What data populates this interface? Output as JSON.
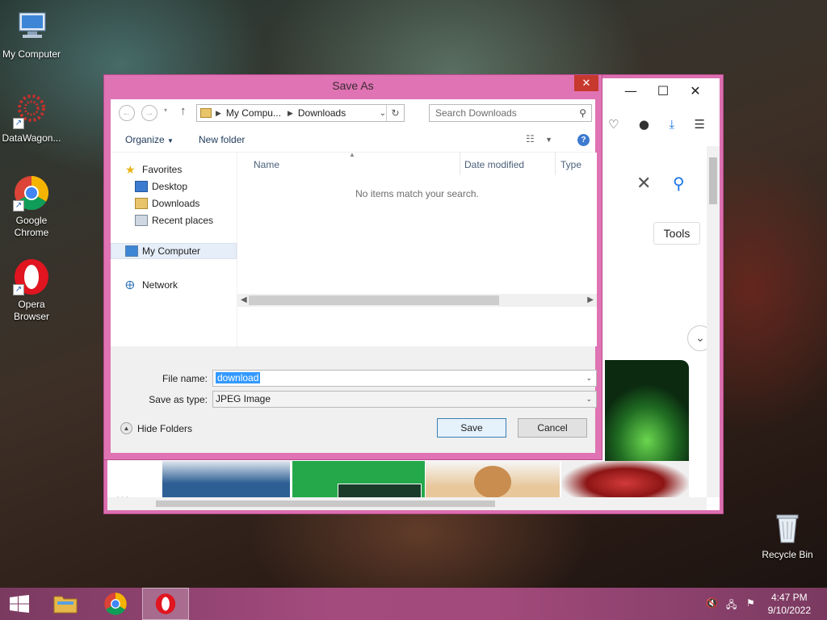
{
  "desktop": {
    "icons": [
      {
        "label": "My Computer",
        "icon": "computer-icon"
      },
      {
        "label": "DataWagon...",
        "icon": "datawagon-icon"
      },
      {
        "label": "Google Chrome",
        "icon": "chrome-icon"
      },
      {
        "label": "Opera Browser",
        "icon": "opera-icon"
      },
      {
        "label": "Recycle Bin",
        "icon": "recycle-bin-icon"
      }
    ]
  },
  "browser": {
    "window_controls": [
      "minimize-icon",
      "maximize-icon",
      "close-icon"
    ],
    "tools_label": "Tools",
    "more_label": "..."
  },
  "dialog": {
    "title": "Save As",
    "address": {
      "root": "My Compu...",
      "folder": "Downloads"
    },
    "search_placeholder": "Search Downloads",
    "organize_label": "Organize",
    "new_folder_label": "New folder",
    "nav": {
      "favorites": "Favorites",
      "desktop": "Desktop",
      "downloads": "Downloads",
      "recent": "Recent places",
      "computer": "My Computer",
      "network": "Network"
    },
    "columns": {
      "name": "Name",
      "date": "Date modified",
      "type": "Type"
    },
    "empty_message": "No items match your search.",
    "file_name_label": "File name:",
    "file_name_value": "download",
    "save_type_label": "Save as type:",
    "save_type_value": "JPEG Image",
    "hide_folders_label": "Hide Folders",
    "save_label": "Save",
    "cancel_label": "Cancel"
  },
  "taskbar": {
    "time": "4:47 PM",
    "date": "9/10/2022",
    "items": [
      "start-icon",
      "file-explorer-icon",
      "chrome-icon",
      "opera-icon"
    ]
  },
  "colors": {
    "window_frame": "#df73b3",
    "taskbar": "#a44b7e",
    "accent": "#3399ff"
  }
}
